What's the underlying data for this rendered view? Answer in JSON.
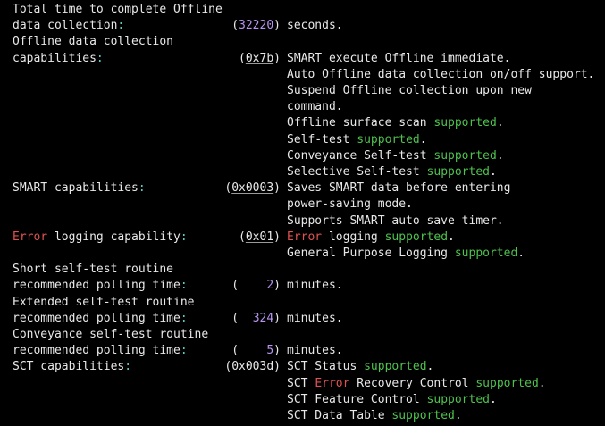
{
  "colors": {
    "background": "#000000",
    "text": "#e8e8e8",
    "colon": "#5cc8c0",
    "supported": "#4ec24e",
    "error": "#e05252",
    "number": "#b694f0"
  },
  "lines": [
    {
      "a": [
        {
          "t": "Total time to complete Offline",
          "c": "white"
        }
      ]
    },
    {
      "a": [
        {
          "t": "data collection",
          "c": "white"
        },
        {
          "t": ":",
          "c": "label"
        }
      ],
      "b": [
        {
          "t": "(",
          "c": "white"
        },
        {
          "t": "32220",
          "c": "purple"
        },
        {
          "t": ")",
          "c": "white"
        }
      ],
      "c": [
        {
          "t": "seconds.",
          "c": "white"
        }
      ]
    },
    {
      "a": [
        {
          "t": "Offline data collection",
          "c": "white"
        }
      ]
    },
    {
      "a": [
        {
          "t": "capabilities",
          "c": "white"
        },
        {
          "t": ":",
          "c": "label"
        }
      ],
      "b": [
        {
          "t": "(",
          "c": "white"
        },
        {
          "t": "0x7b",
          "c": "hex"
        },
        {
          "t": ")",
          "c": "white"
        }
      ],
      "c": [
        {
          "t": "SMART execute Offline immediate.",
          "c": "white"
        }
      ]
    },
    {
      "c": [
        {
          "t": "Auto Offline data collection on/off support.",
          "c": "white"
        }
      ]
    },
    {
      "c": [
        {
          "t": "Suspend Offline collection upon new",
          "c": "white"
        }
      ]
    },
    {
      "c": [
        {
          "t": "command.",
          "c": "white"
        }
      ]
    },
    {
      "c": [
        {
          "t": "Offline surface scan ",
          "c": "white"
        },
        {
          "t": "supported",
          "c": "green"
        },
        {
          "t": ".",
          "c": "white"
        }
      ]
    },
    {
      "c": [
        {
          "t": "Self-test ",
          "c": "white"
        },
        {
          "t": "supported",
          "c": "green"
        },
        {
          "t": ".",
          "c": "white"
        }
      ]
    },
    {
      "c": [
        {
          "t": "Conveyance Self-test ",
          "c": "white"
        },
        {
          "t": "supported",
          "c": "green"
        },
        {
          "t": ".",
          "c": "white"
        }
      ]
    },
    {
      "c": [
        {
          "t": "Selective Self-test ",
          "c": "white"
        },
        {
          "t": "supported",
          "c": "green"
        },
        {
          "t": ".",
          "c": "white"
        }
      ]
    },
    {
      "a": [
        {
          "t": "SMART capabilities",
          "c": "white"
        },
        {
          "t": ":",
          "c": "label"
        }
      ],
      "b": [
        {
          "t": "(",
          "c": "white"
        },
        {
          "t": "0x0003",
          "c": "hex"
        },
        {
          "t": ")",
          "c": "white"
        }
      ],
      "c": [
        {
          "t": "Saves SMART data before entering",
          "c": "white"
        }
      ]
    },
    {
      "c": [
        {
          "t": "power-saving mode.",
          "c": "white"
        }
      ]
    },
    {
      "c": [
        {
          "t": "Supports SMART auto save timer.",
          "c": "white"
        }
      ]
    },
    {
      "a": [
        {
          "t": "Error",
          "c": "red"
        },
        {
          "t": " logging capability",
          "c": "white"
        },
        {
          "t": ":",
          "c": "label"
        }
      ],
      "b": [
        {
          "t": "(",
          "c": "white"
        },
        {
          "t": "0x01",
          "c": "hex"
        },
        {
          "t": ")",
          "c": "white"
        }
      ],
      "c": [
        {
          "t": "Error",
          "c": "red"
        },
        {
          "t": " logging ",
          "c": "white"
        },
        {
          "t": "supported",
          "c": "green"
        },
        {
          "t": ".",
          "c": "white"
        }
      ]
    },
    {
      "c": [
        {
          "t": "General Purpose Logging ",
          "c": "white"
        },
        {
          "t": "supported",
          "c": "green"
        },
        {
          "t": ".",
          "c": "white"
        }
      ]
    },
    {
      "a": [
        {
          "t": "Short self-test routine",
          "c": "white"
        }
      ]
    },
    {
      "a": [
        {
          "t": "recommended polling time",
          "c": "white"
        },
        {
          "t": ":",
          "c": "label"
        }
      ],
      "b": [
        {
          "t": "(    ",
          "c": "white"
        },
        {
          "t": "2",
          "c": "purple"
        },
        {
          "t": ")",
          "c": "white"
        }
      ],
      "c": [
        {
          "t": "minutes.",
          "c": "white"
        }
      ]
    },
    {
      "a": [
        {
          "t": "Extended self-test routine",
          "c": "white"
        }
      ]
    },
    {
      "a": [
        {
          "t": "recommended polling time",
          "c": "white"
        },
        {
          "t": ":",
          "c": "label"
        }
      ],
      "b": [
        {
          "t": "(  ",
          "c": "white"
        },
        {
          "t": "324",
          "c": "purple"
        },
        {
          "t": ")",
          "c": "white"
        }
      ],
      "c": [
        {
          "t": "minutes.",
          "c": "white"
        }
      ]
    },
    {
      "a": [
        {
          "t": "Conveyance self-test routine",
          "c": "white"
        }
      ]
    },
    {
      "a": [
        {
          "t": "recommended polling time",
          "c": "white"
        },
        {
          "t": ":",
          "c": "label"
        }
      ],
      "b": [
        {
          "t": "(    ",
          "c": "white"
        },
        {
          "t": "5",
          "c": "purple"
        },
        {
          "t": ")",
          "c": "white"
        }
      ],
      "c": [
        {
          "t": "minutes.",
          "c": "white"
        }
      ]
    },
    {
      "a": [
        {
          "t": "SCT capabilities",
          "c": "white"
        },
        {
          "t": ":",
          "c": "label"
        }
      ],
      "b": [
        {
          "t": "(",
          "c": "white"
        },
        {
          "t": "0x003d",
          "c": "hex"
        },
        {
          "t": ")",
          "c": "white"
        }
      ],
      "c": [
        {
          "t": "SCT Status ",
          "c": "white"
        },
        {
          "t": "supported",
          "c": "green"
        },
        {
          "t": ".",
          "c": "white"
        }
      ]
    },
    {
      "c": [
        {
          "t": "SCT ",
          "c": "white"
        },
        {
          "t": "Error",
          "c": "red"
        },
        {
          "t": " Recovery Control ",
          "c": "white"
        },
        {
          "t": "supported",
          "c": "green"
        },
        {
          "t": ".",
          "c": "white"
        }
      ]
    },
    {
      "c": [
        {
          "t": "SCT Feature Control ",
          "c": "white"
        },
        {
          "t": "supported",
          "c": "green"
        },
        {
          "t": ".",
          "c": "white"
        }
      ]
    },
    {
      "c": [
        {
          "t": "SCT Data Table ",
          "c": "white"
        },
        {
          "t": "supported",
          "c": "green"
        },
        {
          "t": ".",
          "c": "white"
        }
      ]
    }
  ]
}
